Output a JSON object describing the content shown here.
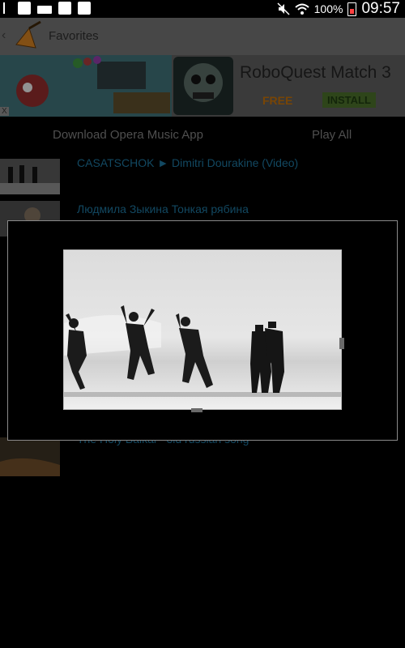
{
  "status_bar": {
    "battery_percent": "100%",
    "clock": "09:57"
  },
  "action_bar": {
    "title": "Favorites"
  },
  "ad": {
    "title": "RoboQuest Match 3",
    "free_label": "FREE",
    "install_label": "INSTALL",
    "close_label": "X"
  },
  "toolbar": {
    "download_label": "Download Opera Music App",
    "play_all_label": "Play All"
  },
  "list": [
    {
      "title": "CASATSCHOK ► Dimitri Dourakine   (Video)"
    },
    {
      "title": "Людмила Зыкина Тонкая рябина"
    },
    {
      "title": "The Holy Baikal - old russian song"
    }
  ],
  "colors": {
    "link": "#1c6f96",
    "action_bar": "#6e6e6e",
    "free": "#b86a08",
    "install": "#476a28"
  }
}
